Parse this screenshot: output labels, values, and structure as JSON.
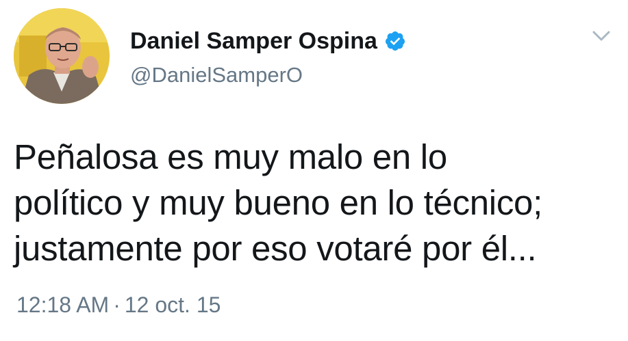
{
  "tweet": {
    "author": {
      "display_name": "Daniel Samper Ospina",
      "handle": "@DanielSamperO",
      "verified": true,
      "verified_icon": "verified-badge-icon",
      "avatar_icon": "avatar"
    },
    "menu_icon": "chevron-down-icon",
    "text": "Peñalosa es muy malo en lo\npolítico y muy bueno en lo técnico;\njustamente por eso votaré por él...",
    "time": "12:18 AM",
    "separator": "·",
    "date": "12 oct. 15"
  },
  "colors": {
    "text": "#14171a",
    "secondary": "#657786",
    "verified": "#1da1f2",
    "background": "#ffffff"
  }
}
